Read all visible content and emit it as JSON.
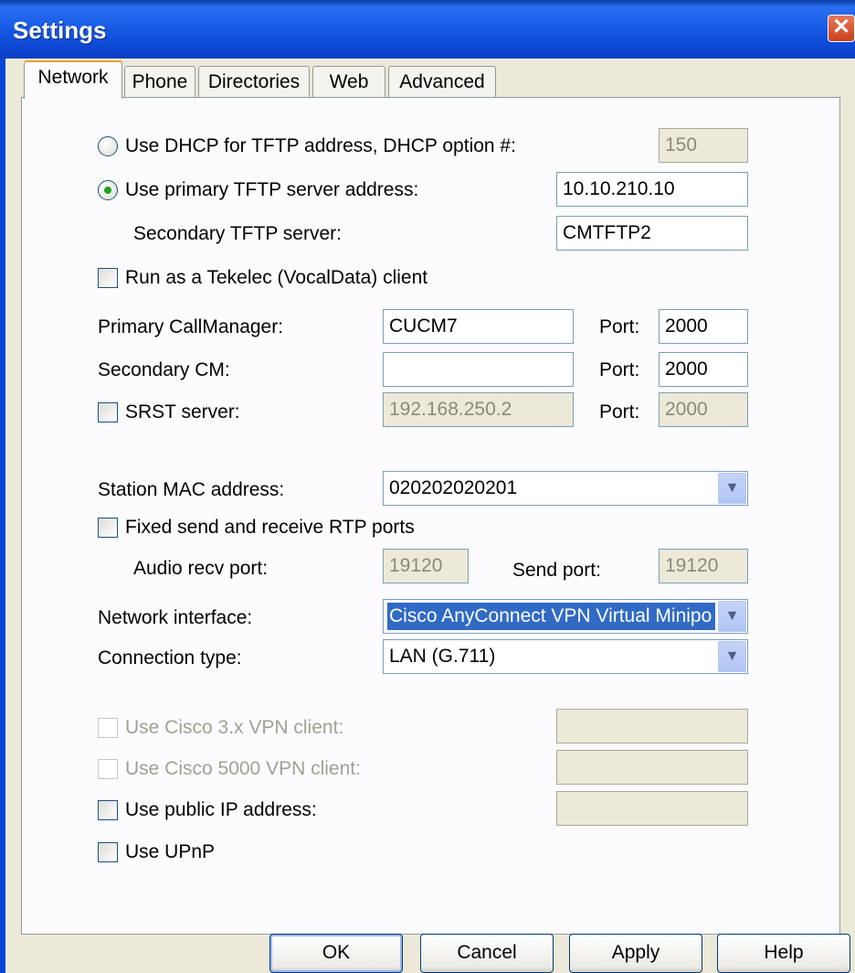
{
  "window": {
    "title": "Settings"
  },
  "tabs": [
    "Network",
    "Phone",
    "Directories",
    "Web",
    "Advanced"
  ],
  "tftp": {
    "dhcp_label": "Use DHCP for TFTP address, DHCP option #:",
    "dhcp_value": "150",
    "primary_label": "Use primary TFTP server address:",
    "primary_value": "10.10.210.10",
    "secondary_label": "Secondary TFTP server:",
    "secondary_value": "CMTFTP2"
  },
  "tekelec_label": "Run as a Tekelec (VocalData) client",
  "callmanager": {
    "primary_label": "Primary CallManager:",
    "primary_value": "CUCM7",
    "secondary_label": "Secondary CM:",
    "secondary_value": "",
    "srst_label": "SRST server:",
    "srst_value": "192.168.250.2",
    "port_label": "Port:",
    "primary_port": "2000",
    "secondary_port": "2000",
    "srst_port": "2000"
  },
  "station": {
    "mac_label": "Station MAC address:",
    "mac_value": "020202020201",
    "fixed_rtp_label": "Fixed send and receive RTP ports",
    "audio_recv_label": "Audio recv port:",
    "audio_recv_value": "19120",
    "send_port_label": "Send port:",
    "send_port_value": "19120"
  },
  "network": {
    "interface_label": "Network interface:",
    "interface_value": "Cisco AnyConnect VPN Virtual Minipo",
    "connection_label": "Connection type:",
    "connection_value": "LAN (G.711)"
  },
  "vpn": {
    "cisco3x_label": "Use Cisco 3.x VPN client:",
    "cisco5000_label": "Use Cisco 5000 VPN client:",
    "public_ip_label": "Use public IP address:",
    "upnp_label": "Use UPnP"
  },
  "buttons": {
    "ok": "OK",
    "cancel": "Cancel",
    "apply": "Apply",
    "help": "Help"
  },
  "colors": {
    "titlebar": "#0a4ad6",
    "selection": "#316ac5",
    "radio_dot": "#21a121",
    "tab_highlight": "#f0a030"
  },
  "icons": {
    "close": "close-icon",
    "dropdown": "chevron-down-icon"
  }
}
